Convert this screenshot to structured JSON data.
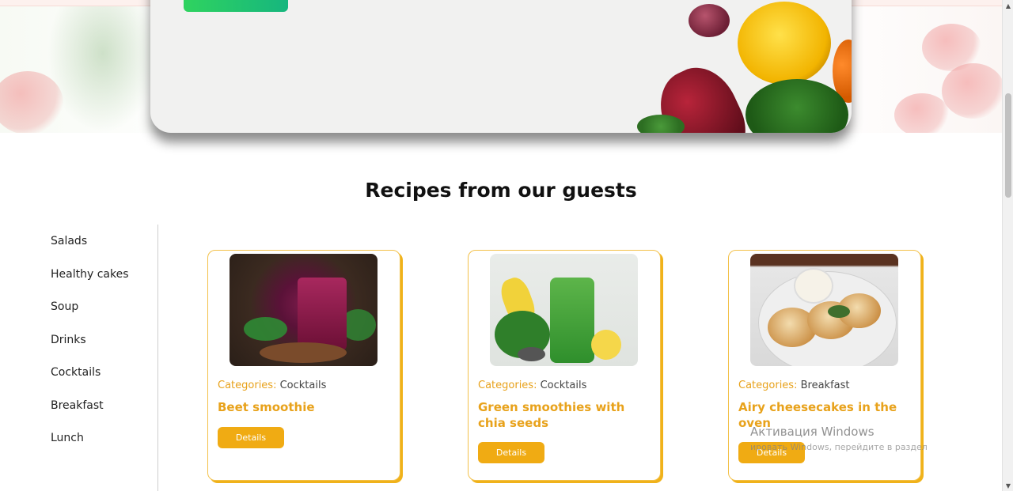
{
  "section": {
    "title": "Recipes from our guests"
  },
  "sidebar": {
    "items": [
      {
        "label": "Salads"
      },
      {
        "label": "Healthy cakes"
      },
      {
        "label": "Soup"
      },
      {
        "label": "Drinks"
      },
      {
        "label": "Cocktails"
      },
      {
        "label": "Breakfast"
      },
      {
        "label": "Lunch"
      }
    ]
  },
  "cards": [
    {
      "category_label": "Categories:",
      "category": "Cocktails",
      "title": "Beet smoothie",
      "button": "Details"
    },
    {
      "category_label": "Categories:",
      "category": "Cocktails",
      "title": "Green smoothies with chia seeds",
      "button": "Details"
    },
    {
      "category_label": "Categories:",
      "category": "Breakfast",
      "title": "Airy cheesecakes in the oven",
      "button": "Details"
    }
  ],
  "watermark": {
    "title": "Активация Windows",
    "subtitle": "ировать Windows, перейдите в раздел"
  },
  "colors": {
    "accent": "#e8a21b",
    "button": "#f0ab13",
    "hero_button": "#2fd35f"
  }
}
